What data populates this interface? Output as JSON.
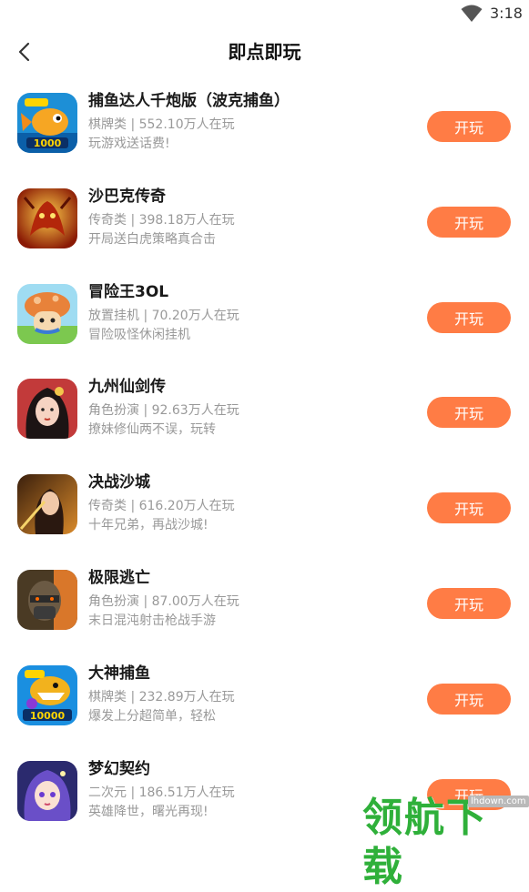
{
  "status_bar": {
    "time": "3:18",
    "wifi_icon": "wifi-icon"
  },
  "header": {
    "title": "即点即玩",
    "back_icon": "chevron-left-icon"
  },
  "colors": {
    "play_button": "#ff7c45",
    "meta_text": "#999999",
    "title_text": "#1a1a1a"
  },
  "games": [
    {
      "name": "捕鱼达人千炮版（波克捕鱼）",
      "meta": "棋牌类 | 552.10万人在玩",
      "desc": "玩游戏送话费!",
      "play_label": "开玩",
      "icon": "fish-game-icon"
    },
    {
      "name": "沙巴克传奇",
      "meta": "传奇类 | 398.18万人在玩",
      "desc": "开局送白虎策略真合击",
      "play_label": "开玩",
      "icon": "dragon-game-icon"
    },
    {
      "name": "冒险王3OL",
      "meta": "放置挂机 | 70.20万人在玩",
      "desc": "冒险吸怪休闲挂机",
      "play_label": "开玩",
      "icon": "mushroom-game-icon"
    },
    {
      "name": "九州仙剑传",
      "meta": "角色扮演 | 92.63万人在玩",
      "desc": "撩妹修仙两不误，玩转",
      "play_label": "开玩",
      "icon": "fairy-game-icon"
    },
    {
      "name": "决战沙城",
      "meta": "传奇类 | 616.20万人在玩",
      "desc": "十年兄弟，再战沙城!",
      "play_label": "开玩",
      "icon": "warrior-game-icon"
    },
    {
      "name": "极限逃亡",
      "meta": "角色扮演 | 87.00万人在玩",
      "desc": "末日混沌射击枪战手游",
      "play_label": "开玩",
      "icon": "soldier-game-icon"
    },
    {
      "name": "大神捕鱼",
      "meta": "棋牌类 | 232.89万人在玩",
      "desc": "爆发上分超简单，轻松",
      "play_label": "开玩",
      "icon": "shark-game-icon"
    },
    {
      "name": "梦幻契约",
      "meta": "二次元 | 186.51万人在玩",
      "desc": "英雄降世，曙光再现!",
      "play_label": "开玩",
      "icon": "anime-girl-game-icon"
    }
  ],
  "watermark": {
    "text": "领航下载",
    "sub": "lhdown.com"
  }
}
